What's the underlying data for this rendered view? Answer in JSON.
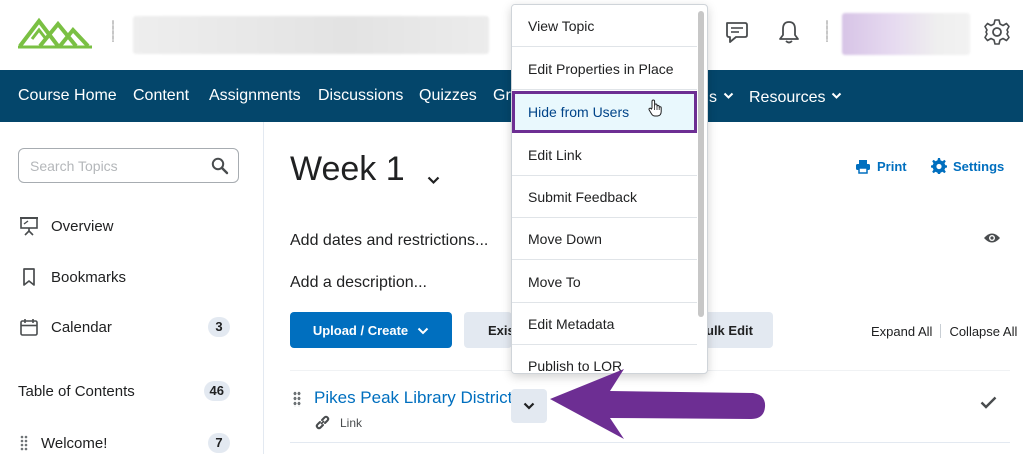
{
  "header": {
    "logo_icon": "mountain-logo-icon",
    "icons": [
      "message-alerts-icon",
      "notification-bell-icon",
      "gear-icon"
    ]
  },
  "nav": {
    "items": [
      {
        "label": "Course Home"
      },
      {
        "label": "Content"
      },
      {
        "label": "Assignments"
      },
      {
        "label": "Discussions"
      },
      {
        "label": "Quizzes"
      },
      {
        "label": "Gr"
      },
      {
        "label": "s"
      },
      {
        "label": "Resources"
      }
    ]
  },
  "sidebar": {
    "search_placeholder": "Search Topics",
    "items": [
      {
        "label": "Overview",
        "icon": "presentation-icon"
      },
      {
        "label": "Bookmarks",
        "icon": "bookmark-icon"
      },
      {
        "label": "Calendar",
        "icon": "calendar-icon",
        "count": "3"
      },
      {
        "label": "Table of Contents",
        "count": "46"
      },
      {
        "label": "Welcome!",
        "count": "7"
      }
    ]
  },
  "main": {
    "title": "Week 1",
    "print_label": "Print",
    "settings_label": "Settings",
    "add_dates": "Add dates and restrictions...",
    "add_description": "Add a description...",
    "upload_label": "Upload / Create",
    "existing_label": "Exis",
    "bulk_edit_label": "ulk Edit",
    "expand_all": "Expand All",
    "collapse_all": "Collapse All",
    "topic": {
      "title": "Pikes Peak Library District",
      "type": "Link"
    }
  },
  "menu": {
    "items": [
      {
        "label": "View Topic"
      },
      {
        "label": "Edit Properties in Place"
      },
      {
        "label": "Hide from Users"
      },
      {
        "label": "Edit Link"
      },
      {
        "label": "Submit Feedback"
      },
      {
        "label": "Move Down"
      },
      {
        "label": "Move To"
      },
      {
        "label": "Edit Metadata"
      },
      {
        "label": "Publish to LOR"
      }
    ],
    "highlighted_index": 2
  },
  "colors": {
    "nav_bg": "#04466b",
    "link": "#006fbf",
    "annotation": "#6d2e93",
    "logo": "#7ac043"
  }
}
